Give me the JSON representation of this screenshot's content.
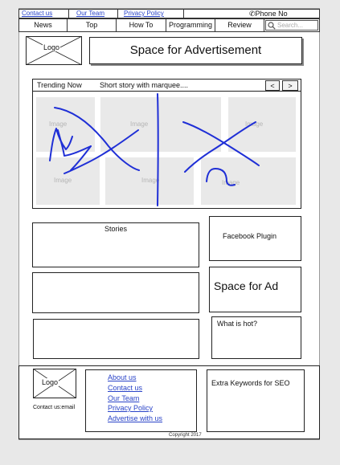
{
  "top_links": {
    "contact": "Contact us",
    "team": "Our Team",
    "privacy": "Privacy Policy",
    "phone": "Phone No"
  },
  "nav": {
    "items": [
      "News",
      "Top",
      "How To",
      "Programming",
      "Review"
    ],
    "search_placeholder": "Search..."
  },
  "header": {
    "logo": "Logo",
    "ad": "Space for Advertisement"
  },
  "trending": {
    "label": "Trending Now",
    "marquee": "Short story with marquee....",
    "prev": "<",
    "next": ">",
    "image_label": "Image"
  },
  "sections": {
    "stories": "Stories",
    "facebook": "Facebook Plugin",
    "ad": "Space for Ad",
    "hot": "What is hot?"
  },
  "footer": {
    "logo": "Logo",
    "contact": "Contact us:email",
    "links": [
      "About us",
      "Contact us",
      "Our Team",
      "Privacy Policy",
      "Advertise with us"
    ],
    "seo": "Extra Keywords for SEO",
    "copyright": "Copyright 2017"
  }
}
